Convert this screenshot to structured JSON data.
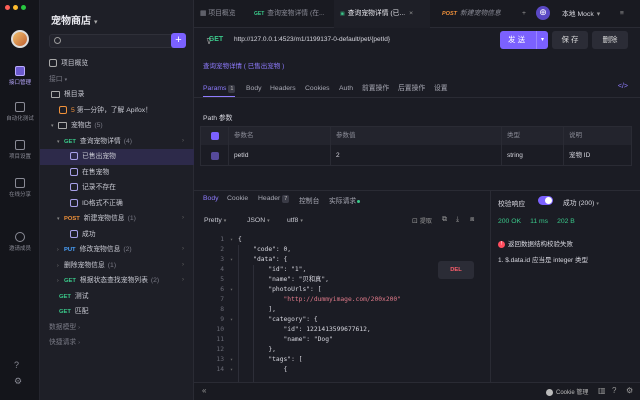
{
  "rail": {
    "items": [
      {
        "label": "接口管理",
        "active": true
      },
      {
        "label": "自动化测试"
      },
      {
        "label": "项目设置"
      },
      {
        "label": "在线分享"
      },
      {
        "label": "邀请成员"
      }
    ]
  },
  "sidebar": {
    "project_title": "宠物商店",
    "items": [
      {
        "label": "项目概览"
      },
      {
        "label": "接口"
      },
      {
        "label": "根目录"
      },
      {
        "label": "第一分钟，了解 Apifox！",
        "badge": "5"
      },
      {
        "label": "宠物店",
        "count": "(5)"
      },
      {
        "method": "GET",
        "label": "查询宠物详情",
        "count": "(4)"
      },
      {
        "label": "已售出宠物"
      },
      {
        "label": "在售宠物"
      },
      {
        "label": "记录不存在"
      },
      {
        "label": "ID格式不正确"
      },
      {
        "method": "POST",
        "label": "新建宠物信息",
        "count": "(1)"
      },
      {
        "label": "成功"
      },
      {
        "method": "PUT",
        "label": "修改宠物信息",
        "count": "(2)"
      },
      {
        "method": "DEL",
        "label": "删除宠物信息",
        "count": "(1)"
      },
      {
        "method": "GET",
        "label": "根据状态查找宠物列表",
        "count": "(2)"
      },
      {
        "method": "GET",
        "label": "测试"
      },
      {
        "method": "GET",
        "label": "匹配"
      },
      {
        "label": "数据模型"
      },
      {
        "label": "快捷请求"
      }
    ]
  },
  "tabs": [
    {
      "label": "项目概览"
    },
    {
      "method": "GET",
      "label": "查询宠物详情 (在..."
    },
    {
      "method": "GET",
      "label": "查询宠物详情 (已...",
      "active": true
    },
    {
      "method": "POST",
      "label": "新建宠物信息"
    }
  ],
  "env": "本地 Mock",
  "request": {
    "method": "GET",
    "url": "http://127.0.0.1:4523/m1/1199137-0-default/pet/{petId}",
    "send": "发 送",
    "save": "保 存",
    "delete": "删除",
    "doc_link": "查询宠物详情 ( 已售出宠物 )"
  },
  "req_tabs": [
    {
      "label": "Params",
      "badge": "1",
      "active": true
    },
    {
      "label": "Body"
    },
    {
      "label": "Headers"
    },
    {
      "label": "Cookies"
    },
    {
      "label": "Auth"
    },
    {
      "label": "前置操作"
    },
    {
      "label": "后置操作"
    },
    {
      "label": "设置"
    }
  ],
  "path_params": {
    "title": "Path 参数",
    "headers": [
      "参数名",
      "参数值",
      "类型",
      "说明"
    ],
    "rows": [
      {
        "name": "petId",
        "value": "2",
        "type": "string",
        "desc": "宠物 ID"
      }
    ]
  },
  "resp_tabs": [
    {
      "label": "Body",
      "active": true
    },
    {
      "label": "Cookie"
    },
    {
      "label": "Header",
      "badge": "7"
    },
    {
      "label": "控制台"
    },
    {
      "label": "实际请求"
    }
  ],
  "resp_format": {
    "pretty": "Pretty",
    "json": "JSON",
    "enc": "utf8",
    "copy": "提取"
  },
  "code_lines": [
    {
      "n": "1",
      "t": "{"
    },
    {
      "n": "2",
      "t": "    \"code\": 0,"
    },
    {
      "n": "3",
      "t": "    \"data\": {"
    },
    {
      "n": "4",
      "t": "        \"id\": \"1\","
    },
    {
      "n": "5",
      "t": "        \"name\": \"贝和真\","
    },
    {
      "n": "6",
      "t": "        \"photoUrls\": ["
    },
    {
      "n": "7",
      "t": "            \"http://dummyimage.com/200x200\""
    },
    {
      "n": "8",
      "t": "        ],"
    },
    {
      "n": "9",
      "t": "        \"category\": {"
    },
    {
      "n": "10",
      "t": "            \"id\": 1221413599677612,"
    },
    {
      "n": "11",
      "t": "            \"name\": \"Dog\""
    },
    {
      "n": "12",
      "t": "        },"
    },
    {
      "n": "13",
      "t": "        \"tags\": ["
    },
    {
      "n": "14",
      "t": "            {"
    }
  ],
  "validation": {
    "label": "校验响应",
    "success": "成功 (200)",
    "status": "200 OK",
    "time": "11 ms",
    "size": "202 B",
    "error_title": "返回数据结构校验失败",
    "error_detail": "1. $.data.id 应当是 integer 类型"
  },
  "footer": {
    "cookie": "Cookie 管理"
  }
}
